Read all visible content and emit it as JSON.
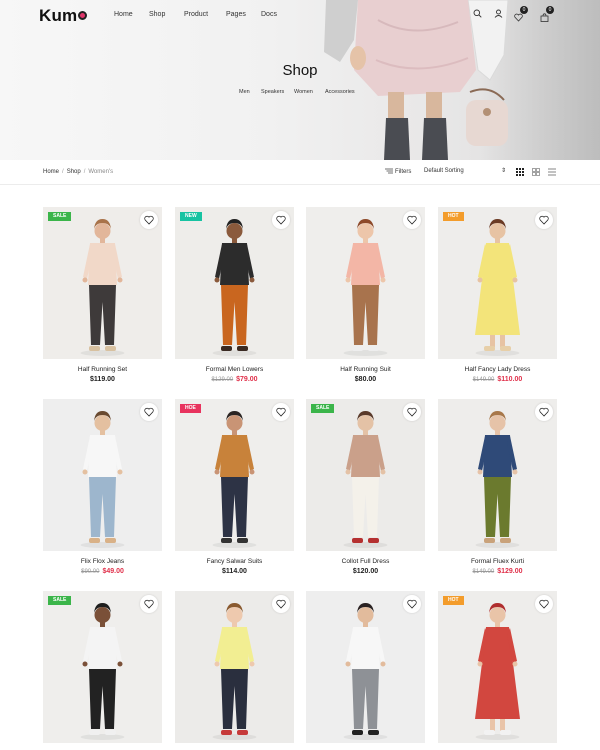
{
  "brand": {
    "name": "Kum"
  },
  "nav": [
    {
      "label": "Home"
    },
    {
      "label": "Shop"
    },
    {
      "label": "Product"
    },
    {
      "label": "Pages"
    },
    {
      "label": "Docs"
    }
  ],
  "header_icons": {
    "wishlist_count": "0",
    "cart_count": "0"
  },
  "hero": {
    "title": "Shop",
    "categories": [
      "Men",
      "Speakers",
      "Women",
      "Accessories"
    ]
  },
  "toolbar": {
    "breadcrumb": [
      "Home",
      "Shop",
      "Women's"
    ],
    "filters_label": "Filters",
    "sort_value": "Default Sorting"
  },
  "colors": {
    "sale_tag": "#3bb54a",
    "new_tag": "#17c3a2",
    "hot_tag": "#f39c2b",
    "hoe_tag": "#e8335e",
    "sale_price": "#e0304a",
    "logo_dot": "#e0366b"
  },
  "products": [
    {
      "name": "Half Running Set",
      "price": "$119.00",
      "old_price": "",
      "tag": "SALE"
    },
    {
      "name": "Formal Men Lowers",
      "price": "$79.00",
      "old_price": "$129.00",
      "tag": "NEW"
    },
    {
      "name": "Half Running Suit",
      "price": "$80.00",
      "old_price": "",
      "tag": ""
    },
    {
      "name": "Half Fancy Lady Dress",
      "price": "$110.00",
      "old_price": "$149.00",
      "tag": "HOT"
    },
    {
      "name": "Flix Flox Jeans",
      "price": "$49.00",
      "old_price": "$90.00",
      "tag": ""
    },
    {
      "name": "Fancy Salwar Suits",
      "price": "$114.00",
      "old_price": "",
      "tag": "HOE"
    },
    {
      "name": "Collot Full Dress",
      "price": "$120.00",
      "old_price": "",
      "tag": "SALE"
    },
    {
      "name": "Formal Fluex Kurti",
      "price": "$129.00",
      "old_price": "$149.00",
      "tag": ""
    },
    {
      "name": "",
      "price": "",
      "old_price": "",
      "tag": "SALE"
    },
    {
      "name": "",
      "price": "",
      "old_price": "",
      "tag": ""
    },
    {
      "name": "",
      "price": "",
      "old_price": "",
      "tag": ""
    },
    {
      "name": "",
      "price": "",
      "old_price": "",
      "tag": "HOT"
    }
  ]
}
